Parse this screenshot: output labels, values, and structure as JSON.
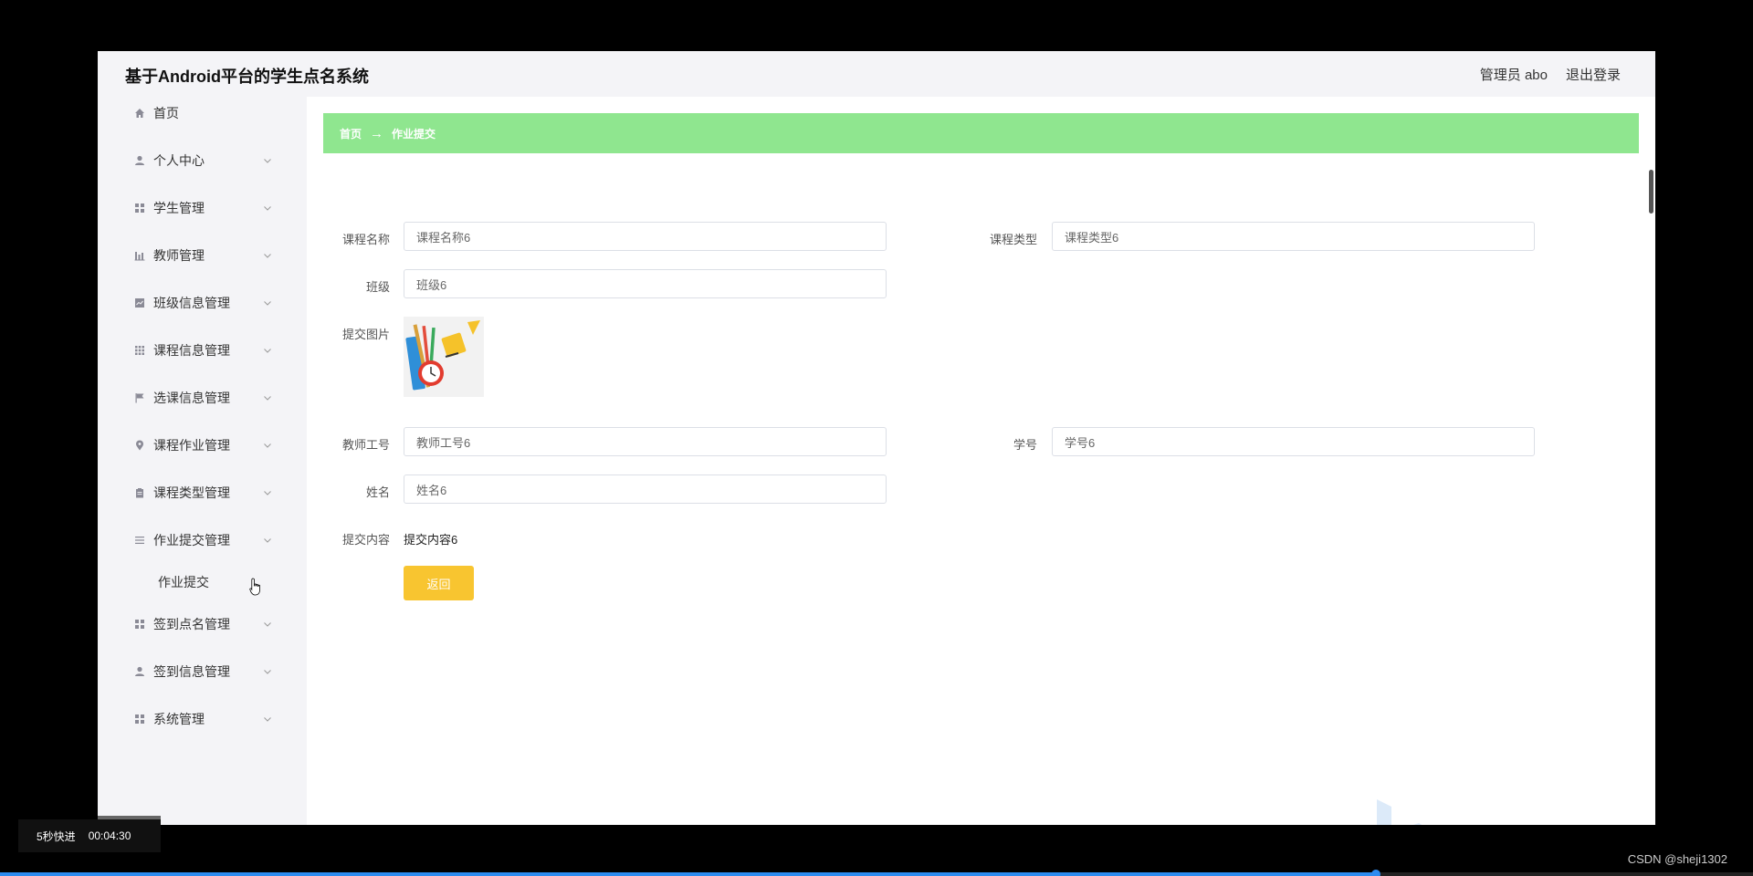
{
  "header": {
    "title": "基于Android平台的学生点名系统",
    "user_label": "管理员 abo",
    "logout_label": "退出登录"
  },
  "sidebar": {
    "items": [
      {
        "label": "首页",
        "icon": "home-icon"
      },
      {
        "label": "个人中心",
        "icon": "person-icon"
      },
      {
        "label": "学生管理",
        "icon": "grid-icon"
      },
      {
        "label": "教师管理",
        "icon": "bar-chart-icon"
      },
      {
        "label": "班级信息管理",
        "icon": "chart-icon"
      },
      {
        "label": "课程信息管理",
        "icon": "apps-icon"
      },
      {
        "label": "选课信息管理",
        "icon": "flag-icon"
      },
      {
        "label": "课程作业管理",
        "icon": "location-icon"
      },
      {
        "label": "课程类型管理",
        "icon": "clipboard-icon"
      },
      {
        "label": "作业提交管理",
        "icon": "list-icon"
      },
      {
        "label": "签到点名管理",
        "icon": "grid-icon"
      },
      {
        "label": "签到信息管理",
        "icon": "person-icon"
      },
      {
        "label": "系统管理",
        "icon": "grid-icon"
      }
    ],
    "submenu": {
      "label": "作业提交"
    }
  },
  "breadcrumb": {
    "home": "首页",
    "arrow": "→",
    "current": "作业提交"
  },
  "form": {
    "course_name": {
      "label": "课程名称",
      "value": "课程名称6"
    },
    "course_type": {
      "label": "课程类型",
      "value": "课程类型6"
    },
    "class": {
      "label": "班级",
      "value": "班级6"
    },
    "image": {
      "label": "提交图片"
    },
    "teacher_id": {
      "label": "教师工号",
      "value": "教师工号6"
    },
    "student_id": {
      "label": "学号",
      "value": "学号6"
    },
    "name": {
      "label": "姓名",
      "value": "姓名6"
    },
    "content": {
      "label": "提交内容",
      "value": "提交内容6"
    },
    "back_label": "返回"
  },
  "video": {
    "speed_label": "5秒快进",
    "time": "00:04:30",
    "progress": 0.785
  },
  "credit": "CSDN @sheji1302",
  "colors": {
    "breadcrumb_bg": "#8fe68f",
    "back_button": "#f8c530",
    "sidebar_bg": "#f4f4f7",
    "progress": "#2d8cf0"
  }
}
